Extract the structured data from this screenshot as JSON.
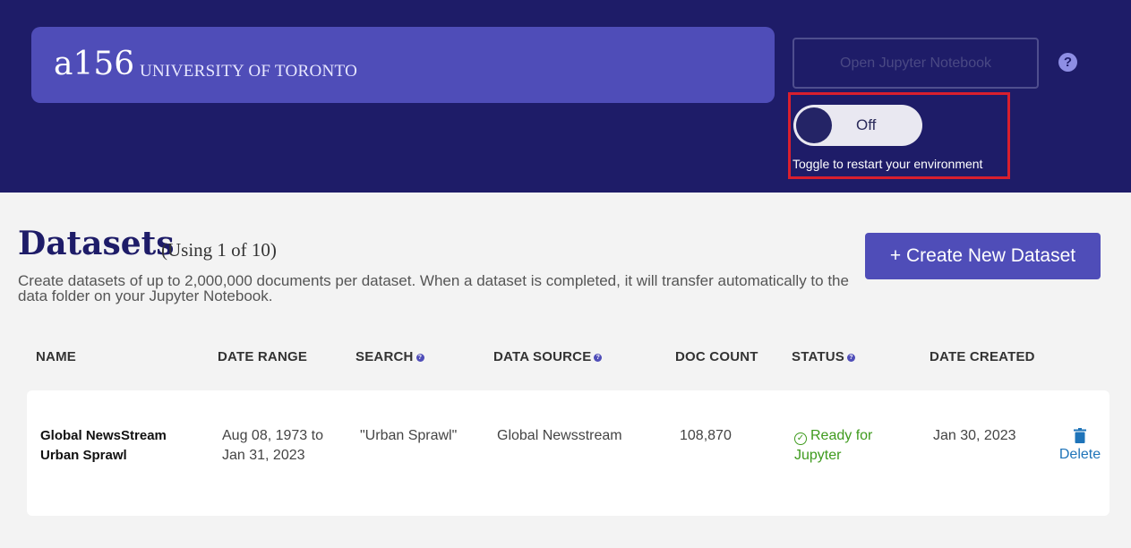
{
  "header": {
    "org_code": "a156",
    "org_name": "UNIVERSITY OF TORONTO",
    "jupyter_button_label": "Open Jupyter Notebook",
    "help_icon": "?",
    "toggle": {
      "state_label": "Off",
      "caption": "Toggle to restart your environment"
    }
  },
  "page": {
    "title": "Datasets",
    "usage": "(Using 1 of 10)",
    "description": "Create datasets of up to 2,000,000 documents per dataset. When a dataset is completed, it will transfer automatically to the data folder on your Jupyter Notebook.",
    "create_button_label": "+ Create New Dataset"
  },
  "table": {
    "headers": {
      "name": "NAME",
      "date_range": "DATE RANGE",
      "search": "SEARCH",
      "data_source": "DATA SOURCE",
      "doc_count": "DOC COUNT",
      "status": "STATUS",
      "date_created": "DATE CREATED"
    },
    "rows": [
      {
        "name": "Global NewsStream Urban Sprawl",
        "date_range": "Aug 08, 1973 to Jan 31, 2023",
        "search": "\"Urban Sprawl\"",
        "data_source": "Global Newsstream",
        "doc_count": "108,870",
        "status": "Ready for Jupyter",
        "date_created": "Jan 30, 2023",
        "delete_label": "Delete"
      }
    ]
  },
  "colors": {
    "header_bg": "#1e1c68",
    "accent": "#4f4db8",
    "status_ready": "#3f9b1e",
    "link": "#1f74b9",
    "highlight": "#d91f2e"
  }
}
